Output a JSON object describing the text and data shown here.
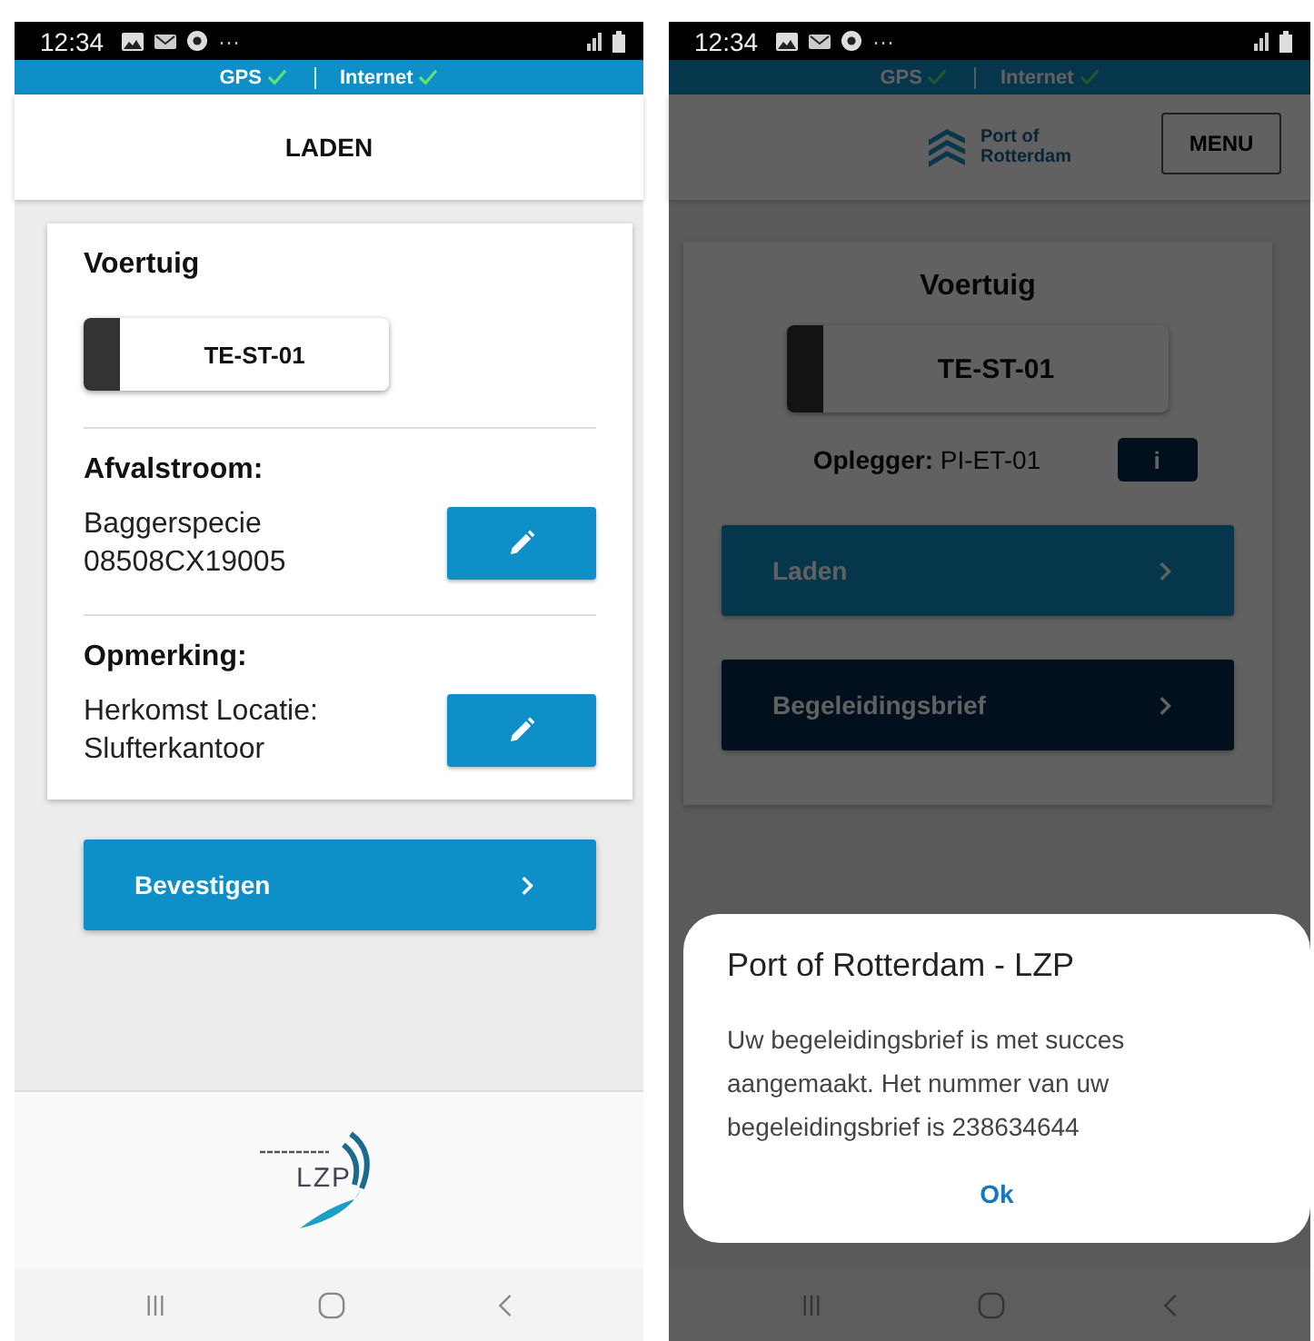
{
  "screens": [
    {
      "kind": "form",
      "status_bar": {
        "time": "12:34",
        "more": "···"
      },
      "connection": [
        {
          "label": "GPS",
          "ok": true
        },
        {
          "label": "Internet",
          "ok": true
        }
      ],
      "header": {
        "title": "LADEN"
      },
      "vehicle": {
        "heading": "Voertuig",
        "plate": "TE-ST-01"
      },
      "sections": [
        {
          "heading": "Afvalstroom:",
          "lines": [
            "Baggerspecie",
            "08508CX19005"
          ]
        },
        {
          "heading": "Opmerking:",
          "lines": [
            "Herkomst Locatie:",
            "Slufterkantoor"
          ]
        }
      ],
      "confirm_button": "Bevestigen",
      "footer_logo": {
        "text": "LZP"
      }
    },
    {
      "kind": "overview",
      "status_bar": {
        "time": "12:34",
        "more": "···"
      },
      "connection": [
        {
          "label": "GPS",
          "ok": true
        },
        {
          "label": "Internet",
          "ok": true
        }
      ],
      "header": {
        "logo_lines": [
          "Port of",
          "Rotterdam"
        ],
        "menu_button": "MENU"
      },
      "vehicle": {
        "heading": "Voertuig",
        "plate": "TE-ST-01"
      },
      "trailer": {
        "text": "**Oplegger:** PI-ET-01",
        "info_button": "i"
      },
      "actions": [
        {
          "label": "Laden",
          "kind": "primary"
        },
        {
          "label": "Begeleidingsbrief",
          "kind": "secondary"
        }
      ],
      "dialog": {
        "title": "Port of Rotterdam - LZP",
        "message": "Uw begeleidingsbrief is met succes aangemaakt. Het nummer van uw begeleidingsbrief is 238634644",
        "button": "Ok"
      }
    }
  ]
}
